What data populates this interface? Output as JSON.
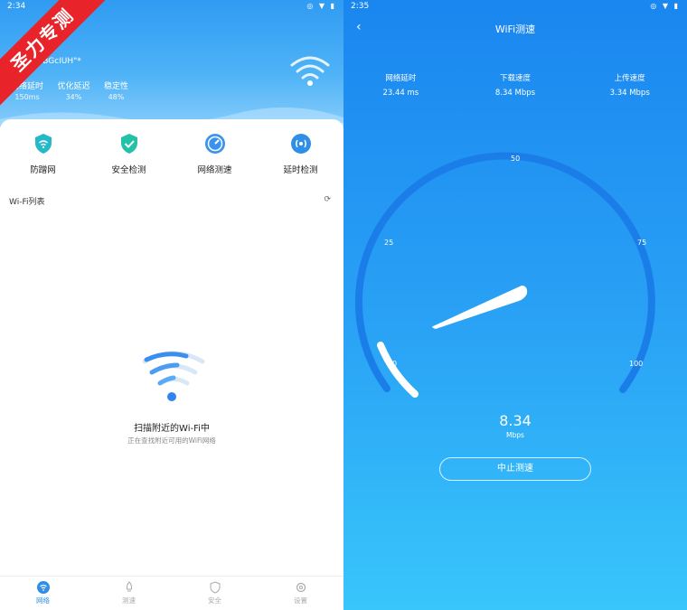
{
  "left": {
    "status_time": "2:34",
    "ssid": "...n-BGcIUH\"*",
    "stats": [
      {
        "label": "网络延时",
        "value": "150ms"
      },
      {
        "label": "优化延迟",
        "value": "34%"
      },
      {
        "label": "稳定性",
        "value": "48%"
      }
    ],
    "features": [
      {
        "label": "防蹭网",
        "icon": "shield-wifi-icon",
        "color": "#25b8c9"
      },
      {
        "label": "安全检测",
        "icon": "shield-check-icon",
        "color": "#22c1a8"
      },
      {
        "label": "网络测速",
        "icon": "speedometer-icon",
        "color": "#3b93f0"
      },
      {
        "label": "延时检测",
        "icon": "signal-icon",
        "color": "#2f8fe8"
      }
    ],
    "list_title": "Wi-Fi列表",
    "refresh_icon": "refresh-icon",
    "scan_title": "扫描附近的Wi-Fi中",
    "scan_subtitle": "正在查找附近可用的WiFi网络",
    "tabs": [
      {
        "label": "网络",
        "icon": "wifi-icon",
        "active": true
      },
      {
        "label": "测速",
        "icon": "rocket-icon",
        "active": false
      },
      {
        "label": "安全",
        "icon": "shield-icon",
        "active": false
      },
      {
        "label": "设置",
        "icon": "gear-icon",
        "active": false
      }
    ],
    "ribbon": "圣力专测"
  },
  "right": {
    "status_time": "2:35",
    "title": "WiFi测速",
    "metrics": [
      {
        "label": "网络延时",
        "value": "23.44 ms"
      },
      {
        "label": "下载速度",
        "value": "8.34 Mbps"
      },
      {
        "label": "上传速度",
        "value": "3.34 Mbps"
      }
    ],
    "gauge_ticks": [
      "0",
      "25",
      "50",
      "75",
      "100"
    ],
    "gauge_value": 8.34,
    "speed": "8.34",
    "unit": "Mbps",
    "stop_button": "中止测速"
  },
  "colors": {
    "brand": "#2f8fe8",
    "header": "#2f9bf2",
    "gauge_bg": "#1678dd",
    "ribbon": "#e8232a"
  }
}
